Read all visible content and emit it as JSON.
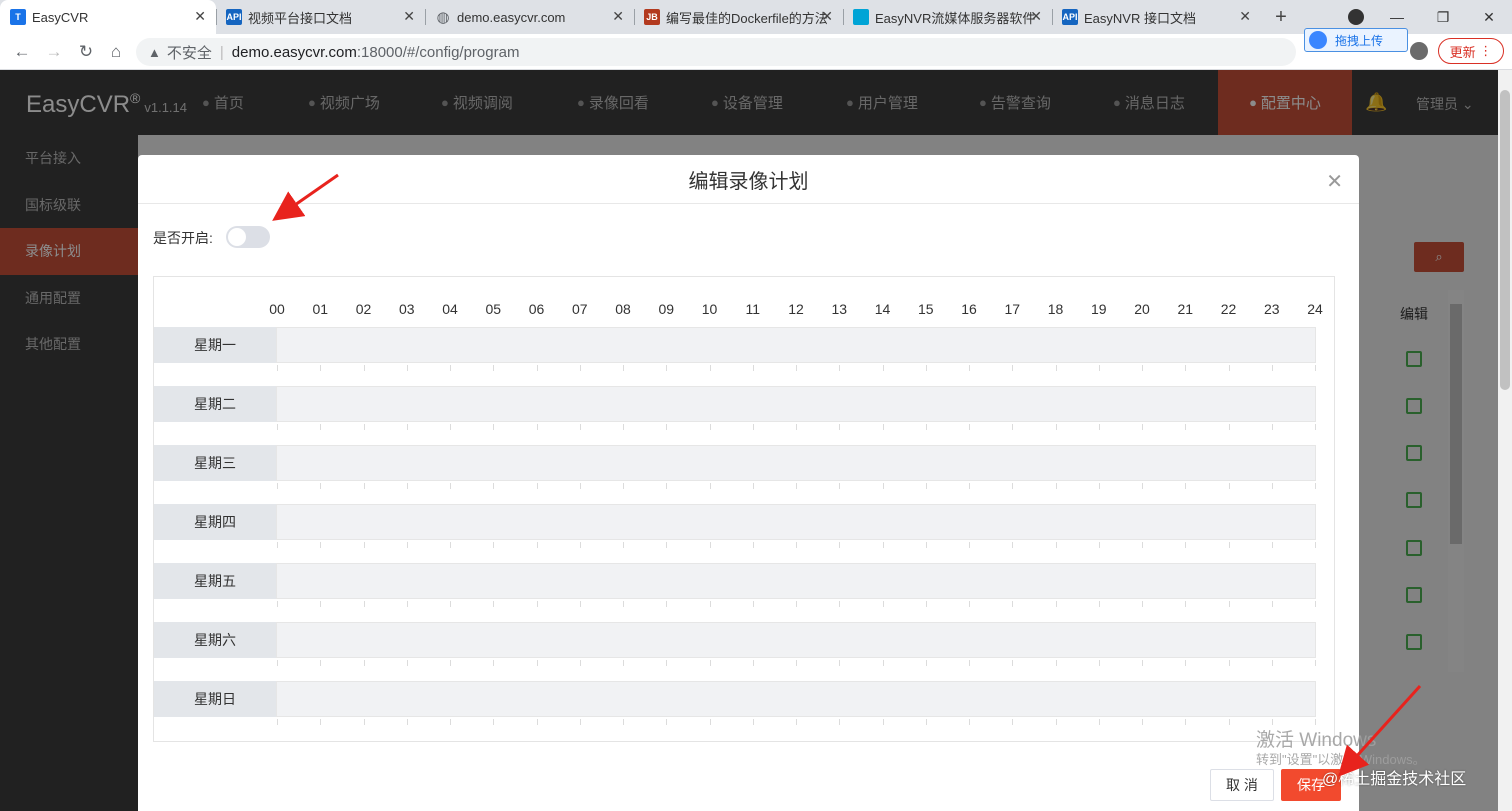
{
  "browser": {
    "tabs": [
      {
        "title": "EasyCVR",
        "favicon": "T",
        "color": "#1a73e8",
        "active": true
      },
      {
        "title": "视频平台接口文档",
        "favicon": "API",
        "color": "#1565c0",
        "active": false
      },
      {
        "title": "demo.easycvr.com",
        "favicon": "globe",
        "color": "#5f6368",
        "active": false
      },
      {
        "title": "编写最佳的Dockerfile的方法",
        "favicon": "JB",
        "color": "#b33a1f",
        "active": false
      },
      {
        "title": "EasyNVR流媒体服务器软件",
        "favicon": "EVR",
        "color": "#00a4d6",
        "active": false
      },
      {
        "title": "EasyNVR 接口文档",
        "favicon": "API",
        "color": "#1565c0",
        "active": false
      }
    ],
    "insecure_label": "不安全",
    "url_host": "demo.easycvr.com",
    "url_path": ":18000/#/config/program",
    "upload_label": "拖拽上传",
    "update_label": "更新"
  },
  "app": {
    "logo": "EasyCVR",
    "logo_mark": "®",
    "version": "v1.1.14",
    "nav": [
      {
        "label": "首页",
        "icon": "dashboard-icon"
      },
      {
        "label": "视频广场",
        "icon": "play-icon"
      },
      {
        "label": "视频调阅",
        "icon": "grid-icon"
      },
      {
        "label": "录像回看",
        "icon": "camera-icon"
      },
      {
        "label": "设备管理",
        "icon": "device-icon"
      },
      {
        "label": "用户管理",
        "icon": "user-icon"
      },
      {
        "label": "告警查询",
        "icon": "alarm-icon"
      },
      {
        "label": "消息日志",
        "icon": "bell-icon"
      },
      {
        "label": "配置中心",
        "icon": "gear-icon",
        "active": true
      }
    ],
    "admin_label": "管理员",
    "sidebar": [
      {
        "label": "平台接入"
      },
      {
        "label": "国标级联"
      },
      {
        "label": "录像计划",
        "active": true
      },
      {
        "label": "通用配置"
      },
      {
        "label": "其他配置"
      }
    ],
    "edit_header": "编辑",
    "accent_color": "#c8513a"
  },
  "dialog": {
    "title": "编辑录像计划",
    "enable_label": "是否开启:",
    "enabled": false,
    "hours": [
      "00",
      "01",
      "02",
      "03",
      "04",
      "05",
      "06",
      "07",
      "08",
      "09",
      "10",
      "11",
      "12",
      "13",
      "14",
      "15",
      "16",
      "17",
      "18",
      "19",
      "20",
      "21",
      "22",
      "23",
      "24"
    ],
    "days": [
      "星期一",
      "星期二",
      "星期三",
      "星期四",
      "星期五",
      "星期六",
      "星期日"
    ],
    "cancel_label": "取 消",
    "save_label": "保存",
    "save_color": "#f24a2e"
  },
  "overlay": {
    "watermark_title": "激活 Windows",
    "watermark_sub": "转到\"设置\"以激活 Windows。",
    "site_watermark": "@稀土掘金技术社区"
  }
}
